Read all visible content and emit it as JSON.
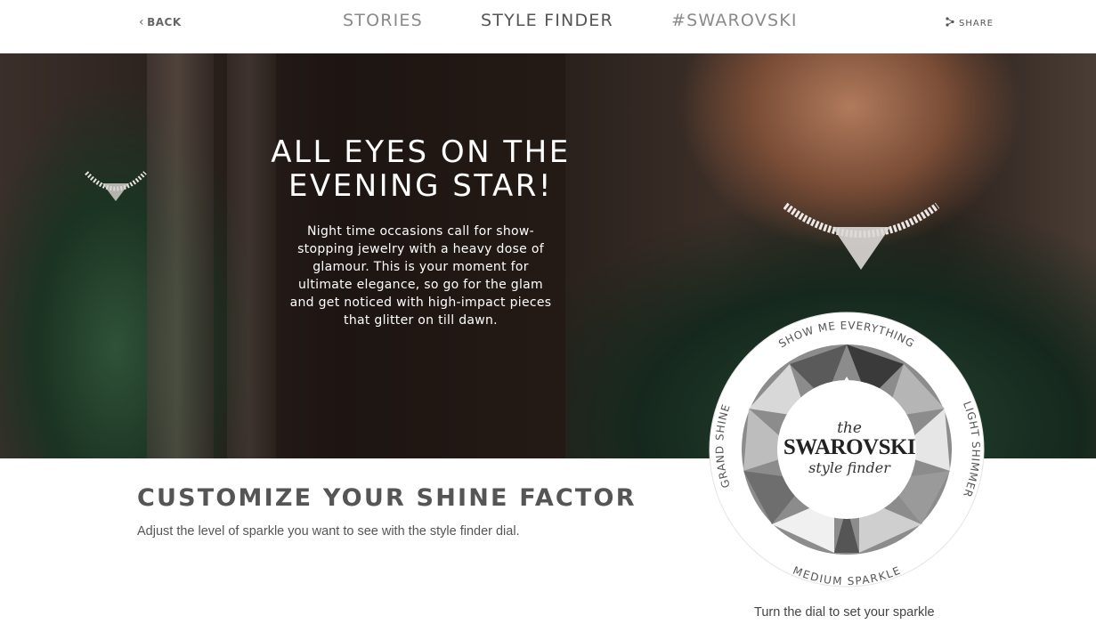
{
  "nav": {
    "back_label": "BACK",
    "links": [
      "STORIES",
      "STYLE FINDER",
      "#SWAROVSKI"
    ],
    "share_label": "SHARE"
  },
  "hero": {
    "title_line1": "ALL EYES ON THE",
    "title_line2": "EVENING STAR!",
    "body": "Night time occasions call for show-stopping jewelry with a heavy dose of glamour. This is your moment for ultimate elegance, so go for the glam and get noticed with high-impact pieces that glitter on till dawn."
  },
  "section": {
    "title": "CUSTOMIZE YOUR SHINE FACTOR",
    "description": "Adjust the level of sparkle you want to see with the style finder dial."
  },
  "dial": {
    "options": {
      "top": "SHOW ME EVERYTHING",
      "right": "LIGHT SHIMMER",
      "bottom": "MEDIUM SPARKLE",
      "left": "GRAND SHINE"
    },
    "center_top": "the",
    "center_brand": "SWAROVSKI",
    "center_bottom": "style finder",
    "hint": "Turn the dial to set your sparkle"
  },
  "colors": {
    "text_gray": "#555555",
    "nav_inactive": "#8a8a8a",
    "velvet_green": "#244432"
  },
  "icons": {
    "back": "chevron-left-icon",
    "share": "share-icon"
  }
}
